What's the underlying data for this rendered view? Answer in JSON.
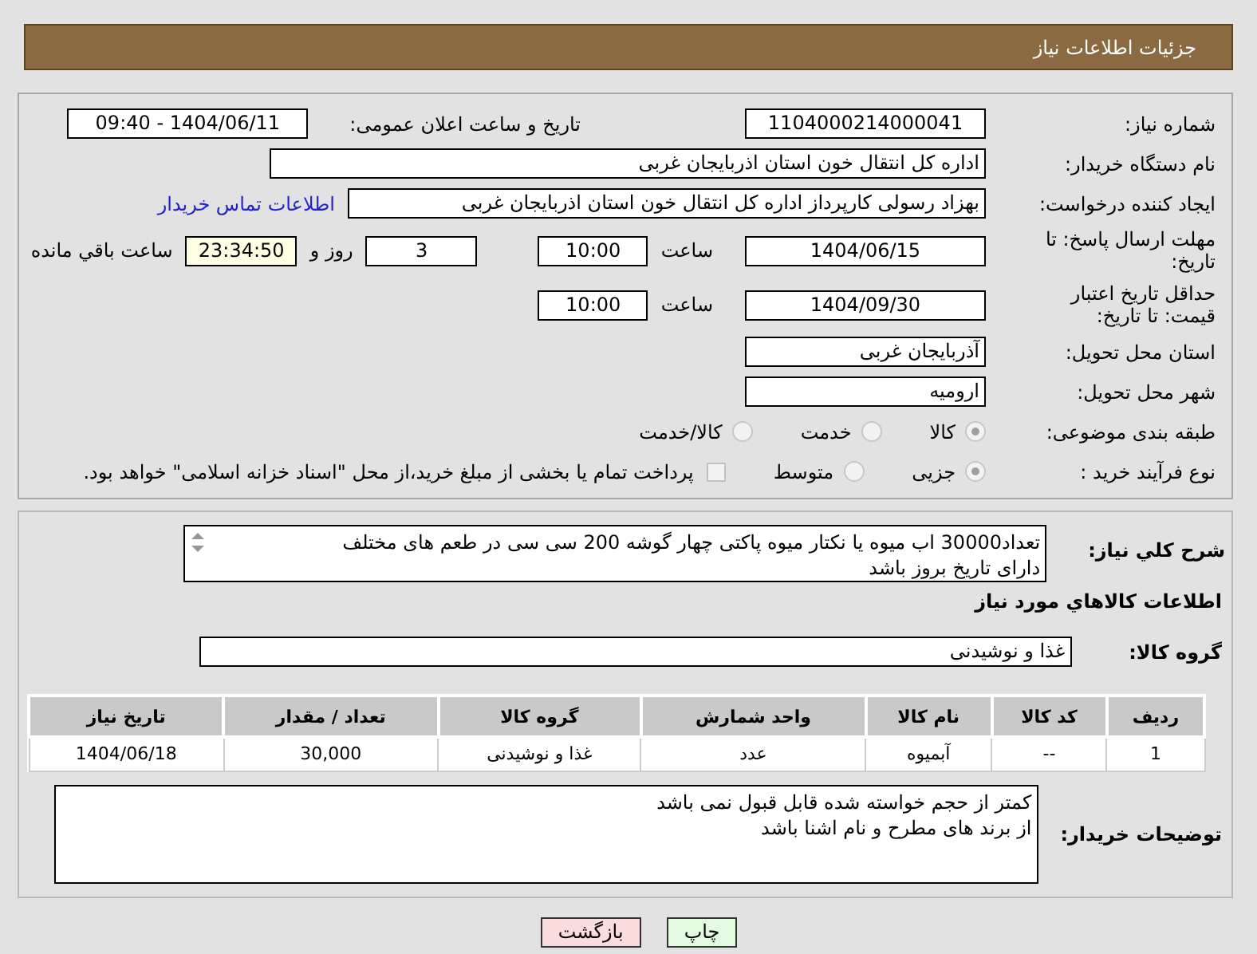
{
  "header": {
    "title": "جزئیات اطلاعات نیاز"
  },
  "need_number": {
    "label": "شماره نیاز:",
    "value": "1104000214000041"
  },
  "announce": {
    "label": "تاریخ و ساعت اعلان عمومی:",
    "value": "1404/06/11 - 09:40"
  },
  "buyer_org": {
    "label": "نام دستگاه خریدار:",
    "value": "اداره کل انتقال خون استان اذربایجان غربی"
  },
  "requester": {
    "label": "ایجاد کننده درخواست:",
    "value": "بهزاد رسولی کارپرداز اداره کل انتقال خون استان اذربایجان غربی",
    "link": "اطلاعات تماس خریدار"
  },
  "deadline": {
    "label": "مهلت ارسال پاسخ: تا تاریخ:",
    "date": "1404/06/15",
    "time_label": "ساعت",
    "time": "10:00",
    "days": "3",
    "days_label": "روز و",
    "remaining": "23:34:50",
    "remaining_label": "ساعت باقي مانده"
  },
  "validity": {
    "label": "حداقل تاریخ اعتبار قیمت: تا تاریخ:",
    "date": "1404/09/30",
    "time_label": "ساعت",
    "time": "10:00"
  },
  "province": {
    "label": "استان محل تحویل:",
    "value": "آذربایجان غربی"
  },
  "city": {
    "label": "شهر محل تحویل:",
    "value": "ارومیه"
  },
  "category": {
    "label": "طبقه بندی موضوعی:",
    "options": [
      {
        "label": "کالا",
        "selected": true
      },
      {
        "label": "خدمت",
        "selected": false
      },
      {
        "label": "کالا/خدمت",
        "selected": false
      }
    ]
  },
  "process": {
    "label": "نوع فرآیند خرید :",
    "options": [
      {
        "label": "جزیی",
        "selected": true
      },
      {
        "label": "متوسط",
        "selected": false
      }
    ],
    "treasury": {
      "checked": false,
      "label": "پرداخت تمام یا بخشی از مبلغ خرید،از محل \"اسناد خزانه اسلامی\" خواهد بود."
    }
  },
  "description": {
    "label": "شرح کلي نیاز:",
    "lines": [
      "تعداد30000 اب میوه یا نکتار میوه پاکتی چهار گوشه 200 سی سی در طعم های مختلف",
      "دارای تاریخ بروز باشد"
    ]
  },
  "goods_heading": "اطلاعات کالاهاي مورد نیاز",
  "goods_group": {
    "label": "گروه کالا:",
    "value": "غذا و نوشیدنی"
  },
  "table": {
    "columns": [
      "ردیف",
      "کد کالا",
      "نام کالا",
      "واحد شمارش",
      "گروه کالا",
      "تعداد / مقدار",
      "تاریخ نیاز"
    ],
    "rows": [
      [
        "1",
        "--",
        "آبمیوه",
        "عدد",
        "غذا و نوشیدنی",
        "30,000",
        "1404/06/18"
      ]
    ]
  },
  "buyer_notes": {
    "label": "توضیحات خریدار:",
    "lines": [
      "کمتر از حجم خواسته شده قابل قبول نمی باشد",
      "از برند های مطرح و نام اشنا باشد"
    ]
  },
  "buttons": [
    {
      "kind": "print",
      "label": "چاپ"
    },
    {
      "kind": "back",
      "label": "بازگشت"
    }
  ]
}
